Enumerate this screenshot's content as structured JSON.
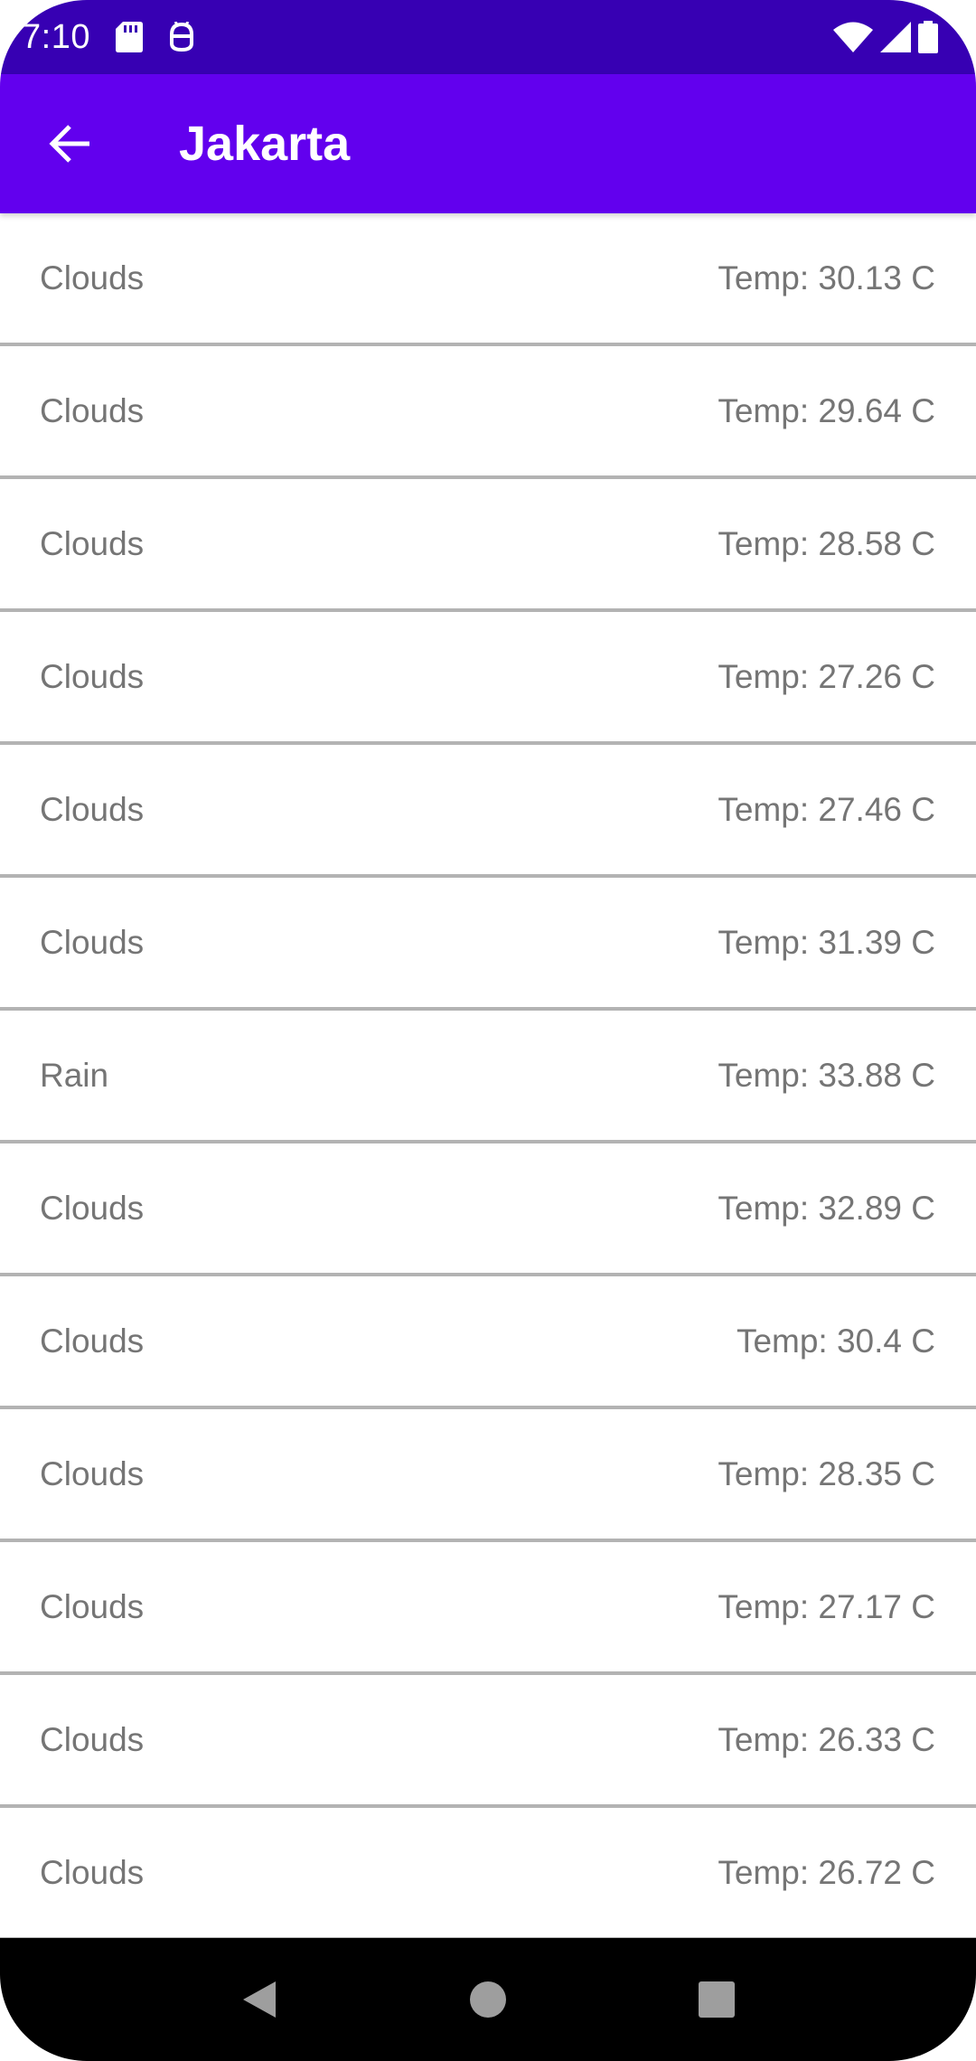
{
  "status_bar": {
    "time": "7:10",
    "left_icons": [
      "sd-card-icon",
      "android-notification-icon"
    ],
    "right_icons": [
      "wifi-icon",
      "cellular-signal-icon",
      "battery-icon"
    ]
  },
  "app_bar": {
    "title": "Jakarta",
    "back_icon": "arrow-back-icon"
  },
  "forecast": [
    {
      "condition": "Clouds",
      "temp": "Temp: 30.13 C"
    },
    {
      "condition": "Clouds",
      "temp": "Temp: 29.64 C"
    },
    {
      "condition": "Clouds",
      "temp": "Temp: 28.58 C"
    },
    {
      "condition": "Clouds",
      "temp": "Temp: 27.26 C"
    },
    {
      "condition": "Clouds",
      "temp": "Temp: 27.46 C"
    },
    {
      "condition": "Clouds",
      "temp": "Temp: 31.39 C"
    },
    {
      "condition": "Rain",
      "temp": "Temp: 33.88 C"
    },
    {
      "condition": "Clouds",
      "temp": "Temp: 32.89 C"
    },
    {
      "condition": "Clouds",
      "temp": "Temp: 30.4 C"
    },
    {
      "condition": "Clouds",
      "temp": "Temp: 28.35 C"
    },
    {
      "condition": "Clouds",
      "temp": "Temp: 27.17 C"
    },
    {
      "condition": "Clouds",
      "temp": "Temp: 26.33 C"
    },
    {
      "condition": "Clouds",
      "temp": "Temp: 26.72 C"
    }
  ],
  "nav_bar": {
    "buttons": [
      "back-triangle-icon",
      "home-circle-icon",
      "recents-square-icon"
    ]
  },
  "colors": {
    "status_bar": "#3700B3",
    "app_bar": "#6200EE",
    "text_secondary": "#757575",
    "divider": "#B3B3B3"
  }
}
